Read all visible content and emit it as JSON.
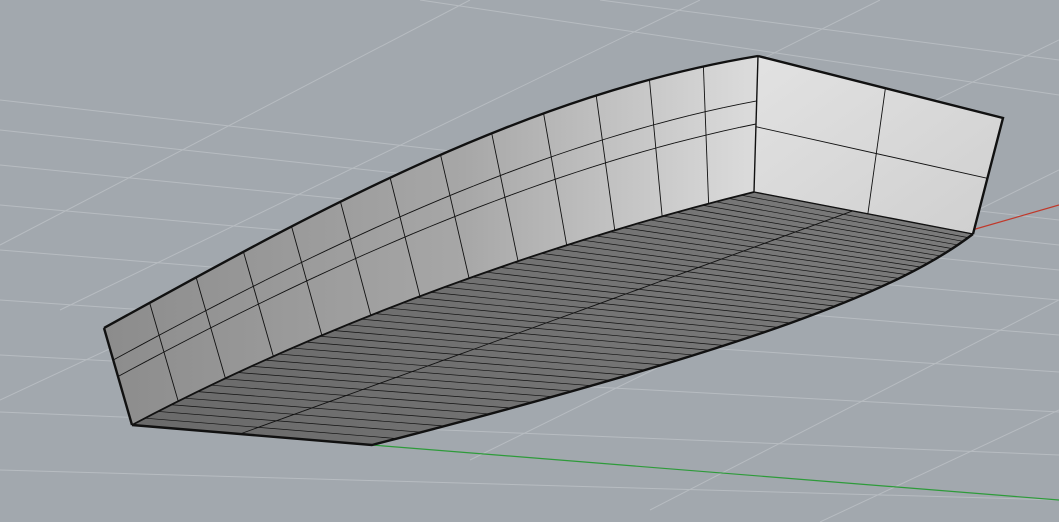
{
  "viewport": {
    "background_color": "#a2a8ae",
    "grid_line_color": "#b7bcc1",
    "x_axis_color": "#c0392b",
    "y_axis_color": "#2e9b3a"
  },
  "model": {
    "side_panel_color": "#8f8f8f",
    "transom_color": "#d9d9d9",
    "bottom_color": "#6f6f6f",
    "edge_color": "#111111"
  }
}
